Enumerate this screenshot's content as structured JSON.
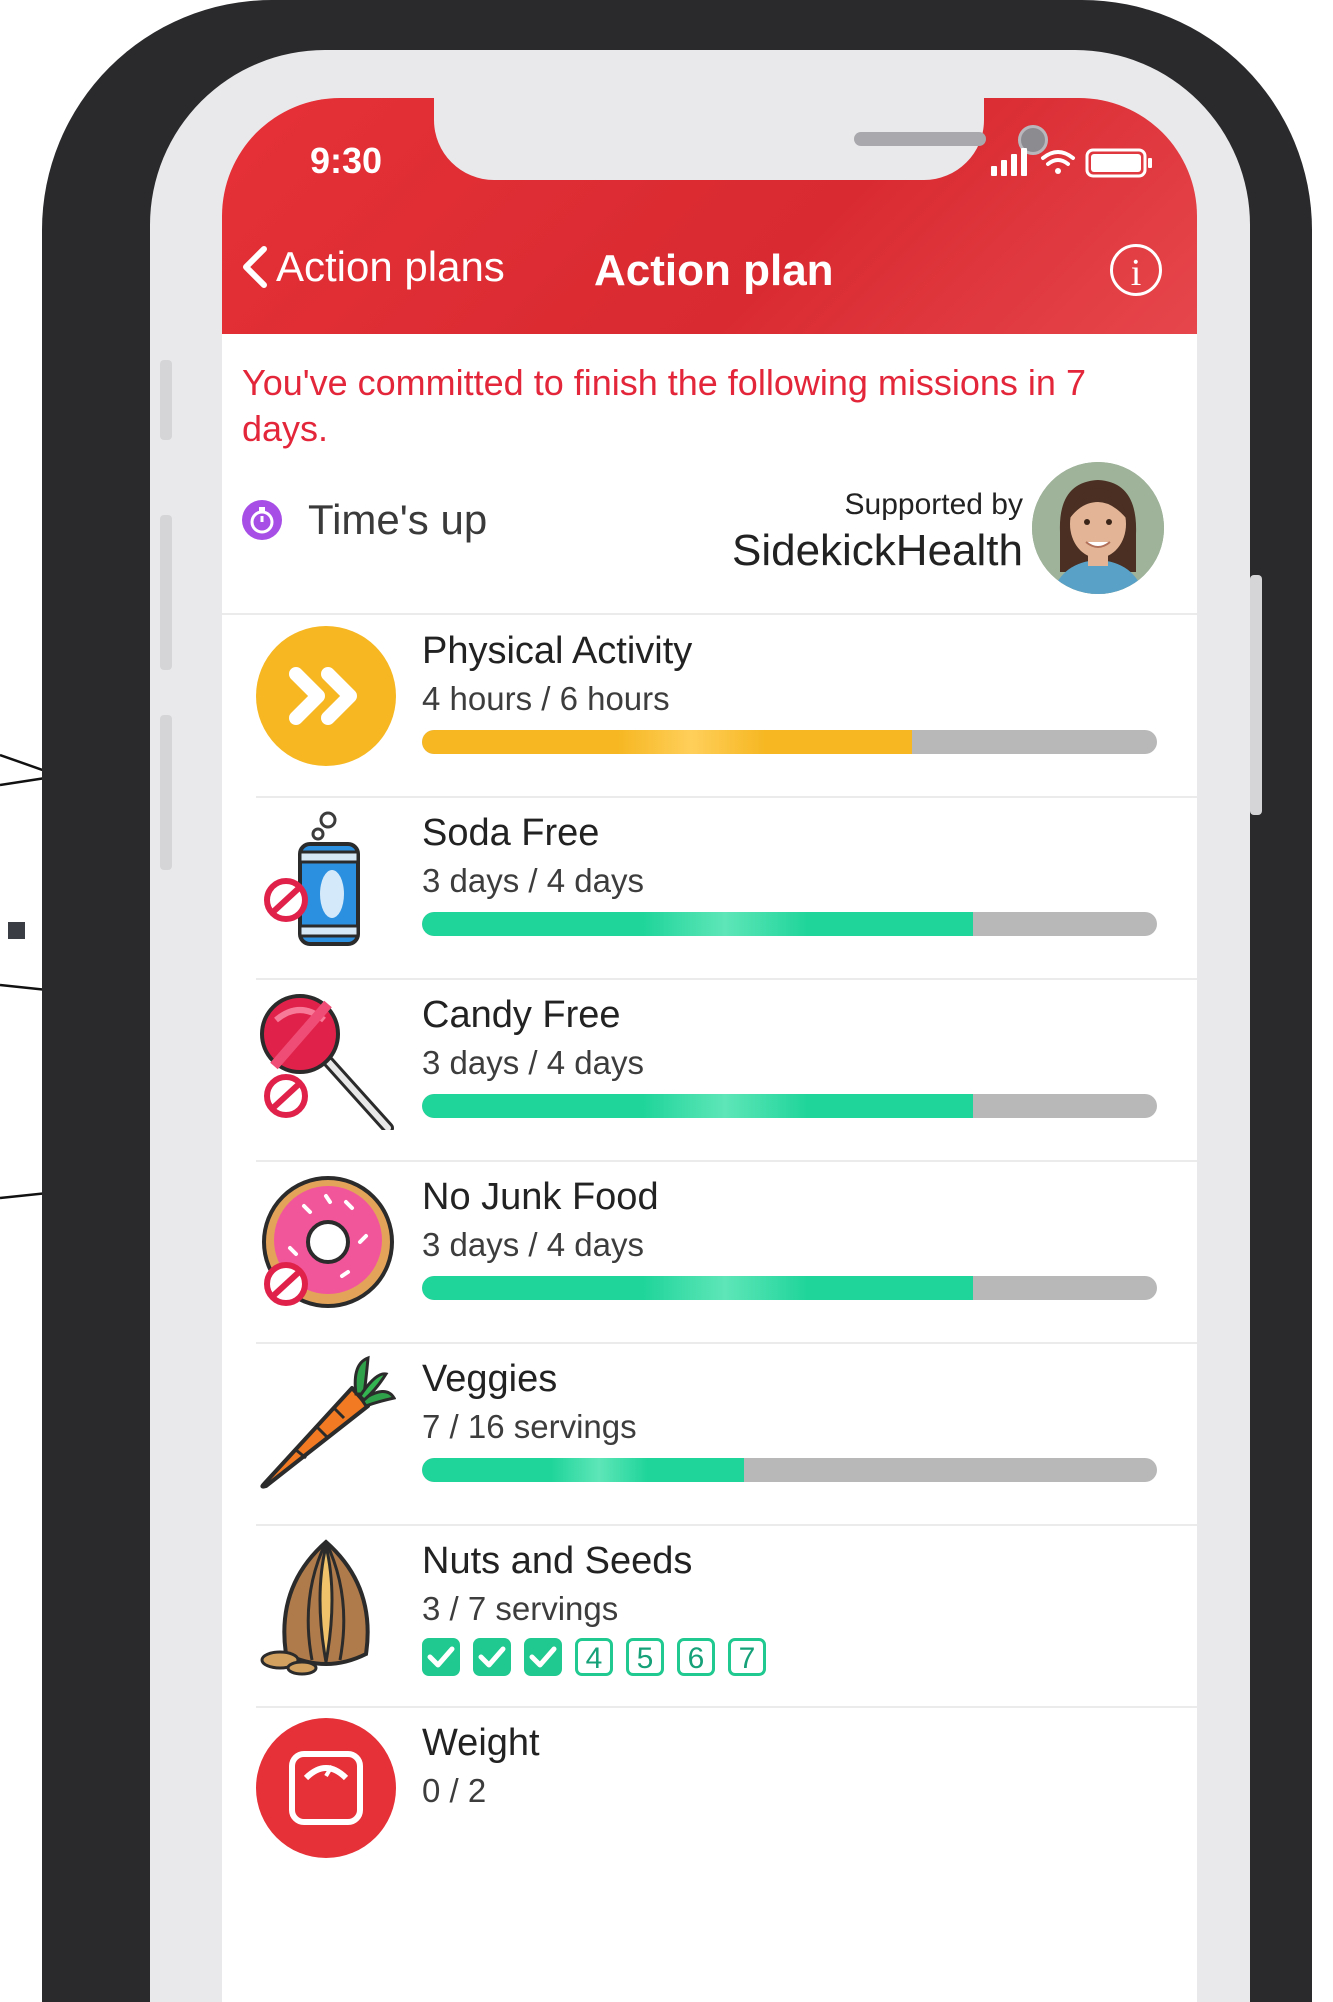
{
  "status_bar": {
    "time": "9:30"
  },
  "nav": {
    "back_label": "Action plans",
    "title": "Action plan",
    "info_glyph": "i"
  },
  "commitment_text": "You've committed to finish the following missions in 7 days.",
  "timer": {
    "label": "Time's up",
    "icon": "stopwatch-icon",
    "color": "#a64ee6"
  },
  "support": {
    "prefix": "Supported by",
    "brand": "SidekickHealth"
  },
  "colors": {
    "accent_red": "#e53137",
    "progress_green": "#1fd59a",
    "progress_yellow": "#f6b722",
    "track_gray": "#b8b8b8"
  },
  "missions": [
    {
      "title": "Physical Activity",
      "detail": "4 hours / 6 hours",
      "progress": 0.667,
      "icon": "fast-forward-icon",
      "bar_color": "#f6b722"
    },
    {
      "title": "Soda Free",
      "detail": "3 days / 4 days",
      "progress": 0.75,
      "icon": "soda-can-icon",
      "bar_color": "#1fd59a"
    },
    {
      "title": "Candy Free",
      "detail": "3 days / 4 days",
      "progress": 0.75,
      "icon": "lollipop-icon",
      "bar_color": "#1fd59a"
    },
    {
      "title": "No Junk Food",
      "detail": "3 days / 4 days",
      "progress": 0.75,
      "icon": "donut-icon",
      "bar_color": "#1fd59a"
    },
    {
      "title": "Veggies",
      "detail": "7 / 16 servings",
      "progress": 0.4375,
      "icon": "carrot-icon",
      "bar_color": "#1fd59a"
    },
    {
      "title": "Nuts and Seeds",
      "detail": "3 / 7 servings",
      "checks": [
        {
          "label": "",
          "done": true
        },
        {
          "label": "",
          "done": true
        },
        {
          "label": "",
          "done": true
        },
        {
          "label": "4",
          "done": false
        },
        {
          "label": "5",
          "done": false
        },
        {
          "label": "6",
          "done": false
        },
        {
          "label": "7",
          "done": false
        }
      ],
      "icon": "seeds-icon"
    },
    {
      "title": "Weight",
      "detail": "0 / 2",
      "icon": "scale-icon"
    }
  ]
}
